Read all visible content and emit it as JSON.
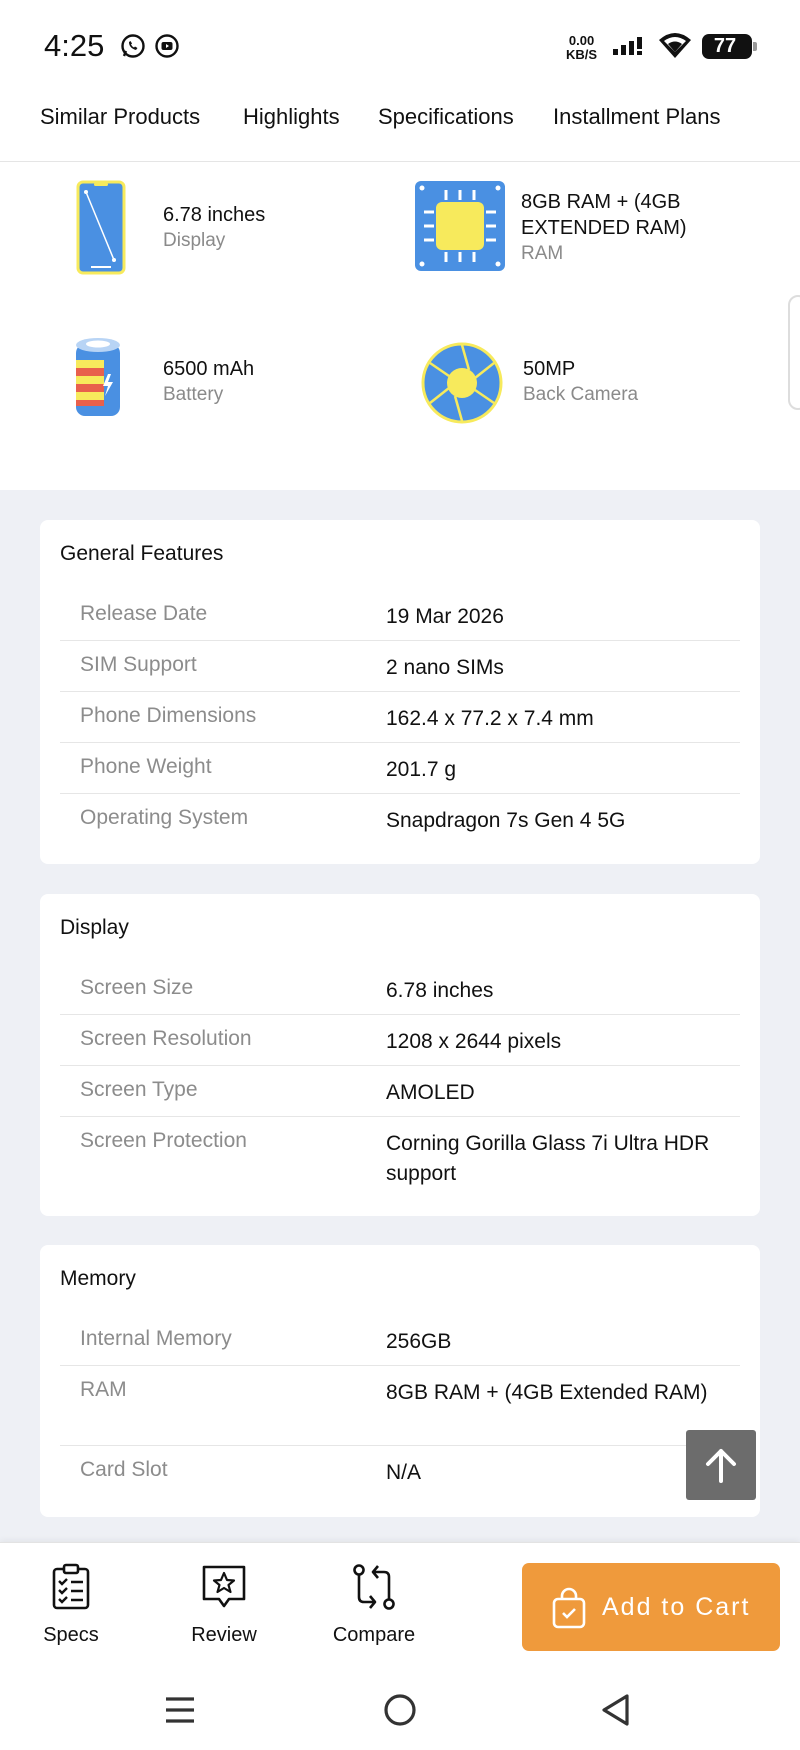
{
  "status_bar": {
    "time": "4:25",
    "net_speed_value": "0.00",
    "net_speed_unit": "KB/S",
    "battery": "77"
  },
  "tabs": [
    {
      "label": "Similar Products"
    },
    {
      "label": "Highlights"
    },
    {
      "label": "Specifications"
    },
    {
      "label": "Installment Plans"
    }
  ],
  "highlights": [
    {
      "value": "6.78 inches",
      "label": "Display",
      "icon": "phone-display-icon"
    },
    {
      "value": "8GB RAM + (4GB EXTENDED RAM)",
      "label": "RAM",
      "icon": "chip-icon"
    },
    {
      "value": "6500 mAh",
      "label": "Battery",
      "icon": "battery-icon"
    },
    {
      "value": "50MP",
      "label": "Back Camera",
      "icon": "camera-aperture-icon"
    }
  ],
  "sections": [
    {
      "title": "General Features",
      "rows": [
        {
          "label": "Release Date",
          "value": "19 Mar 2026"
        },
        {
          "label": "SIM Support",
          "value": "2 nano SIMs"
        },
        {
          "label": "Phone Dimensions",
          "value": "162.4 x 77.2 x 7.4 mm"
        },
        {
          "label": "Phone Weight",
          "value": "201.7 g"
        },
        {
          "label": "Operating System",
          "value": "Snapdragon 7s Gen 4 5G"
        }
      ]
    },
    {
      "title": "Display",
      "rows": [
        {
          "label": "Screen Size",
          "value": "6.78 inches"
        },
        {
          "label": "Screen Resolution",
          "value": "1208 x 2644 pixels"
        },
        {
          "label": "Screen Type",
          "value": "AMOLED"
        },
        {
          "label": "Screen Protection",
          "value": "Corning Gorilla Glass 7i Ultra HDR support"
        }
      ]
    },
    {
      "title": "Memory",
      "rows": [
        {
          "label": "Internal Memory",
          "value": "256GB"
        },
        {
          "label": "RAM",
          "value": "8GB RAM + (4GB Extended RAM)"
        },
        {
          "label": "Card Slot",
          "value": "N/A"
        }
      ]
    }
  ],
  "actions": {
    "specs": "Specs",
    "review": "Review",
    "compare": "Compare",
    "add_to_cart": "Add to Cart"
  },
  "colors": {
    "accent": "#ef9a3c",
    "page_bg": "#eef0f5",
    "label_gray": "#8c8c8c",
    "icon_blue": "#4a90e2",
    "icon_yellow": "#f7ea5c"
  }
}
